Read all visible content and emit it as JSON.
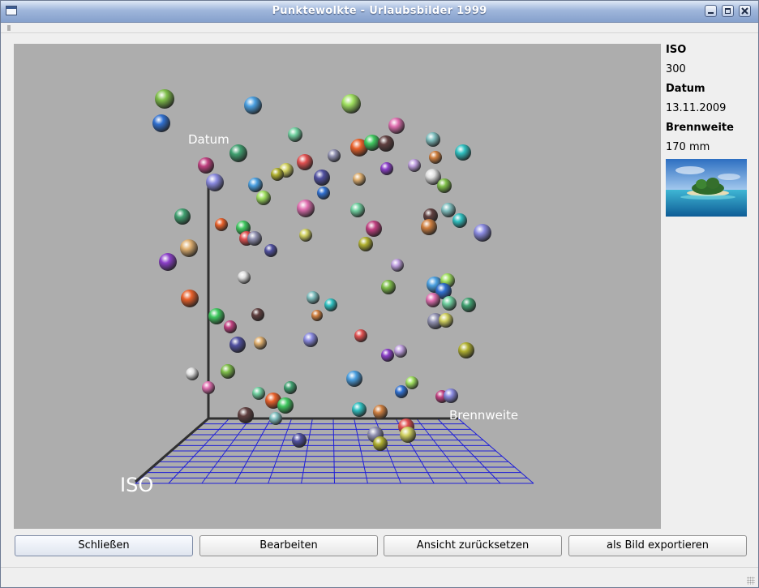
{
  "window": {
    "title": "Punktewolkte - Urlaubsbilder 1999"
  },
  "scene": {
    "axes": {
      "vertical": "Datum",
      "right": "Brennweite",
      "front": "ISO"
    },
    "colors": {
      "background": "#adadad",
      "grid": "#1f1fd8",
      "axis": "#303030"
    }
  },
  "info": {
    "iso_label": "ISO",
    "iso_value": "300",
    "date_label": "Datum",
    "date_value": "13.11.2009",
    "focal_label": "Brennweite",
    "focal_value": "170 mm",
    "thumbnail": "island-photo"
  },
  "buttons": {
    "close": "Schließen",
    "edit": "Bearbeiten",
    "reset": "Ansicht zurücksetzen",
    "export": "als Bild exportieren"
  }
}
